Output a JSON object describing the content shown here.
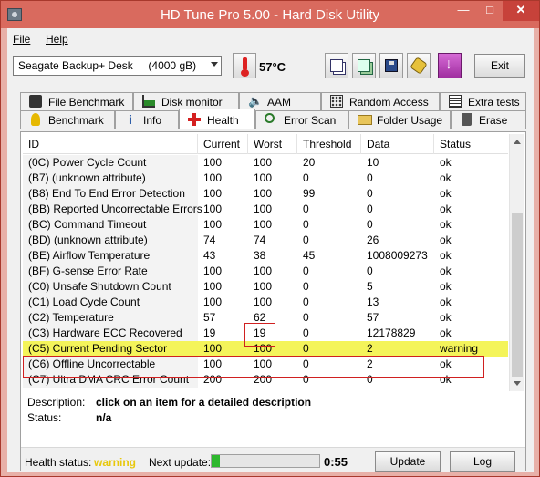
{
  "window": {
    "title": "HD Tune Pro 5.00 - Hard Disk Utility"
  },
  "menu": {
    "file": "File",
    "help": "Help"
  },
  "toolbar": {
    "drive": "Seagate Backup+ Desk     (4000 gB)",
    "temperature": "57°C",
    "exit": "Exit"
  },
  "tabs_top": [
    {
      "label": "File Benchmark",
      "icon": "file-benchmark-icon"
    },
    {
      "label": "Disk monitor",
      "icon": "disk-monitor-icon"
    },
    {
      "label": "AAM",
      "icon": "speaker-icon"
    },
    {
      "label": "Random Access",
      "icon": "random-access-icon"
    },
    {
      "label": "Extra tests",
      "icon": "extra-tests-icon"
    }
  ],
  "tabs_bottom": [
    {
      "label": "Benchmark",
      "icon": "benchmark-icon"
    },
    {
      "label": "Info",
      "icon": "info-icon"
    },
    {
      "label": "Health",
      "icon": "health-cross-icon",
      "active": true
    },
    {
      "label": "Error Scan",
      "icon": "error-scan-icon"
    },
    {
      "label": "Folder Usage",
      "icon": "folder-icon"
    },
    {
      "label": "Erase",
      "icon": "trash-icon"
    }
  ],
  "health_table": {
    "columns": [
      "ID",
      "Current",
      "Worst",
      "Threshold",
      "Data",
      "Status"
    ],
    "rows": [
      {
        "id": "(0C) Power Cycle Count",
        "current": "100",
        "worst": "100",
        "threshold": "20",
        "data": "10",
        "status": "ok"
      },
      {
        "id": "(B7) (unknown attribute)",
        "current": "100",
        "worst": "100",
        "threshold": "0",
        "data": "0",
        "status": "ok"
      },
      {
        "id": "(B8) End To End Error Detection",
        "current": "100",
        "worst": "100",
        "threshold": "99",
        "data": "0",
        "status": "ok"
      },
      {
        "id": "(BB) Reported Uncorrectable Errors",
        "current": "100",
        "worst": "100",
        "threshold": "0",
        "data": "0",
        "status": "ok"
      },
      {
        "id": "(BC) Command Timeout",
        "current": "100",
        "worst": "100",
        "threshold": "0",
        "data": "0",
        "status": "ok"
      },
      {
        "id": "(BD) (unknown attribute)",
        "current": "74",
        "worst": "74",
        "threshold": "0",
        "data": "26",
        "status": "ok"
      },
      {
        "id": "(BE) Airflow Temperature",
        "current": "43",
        "worst": "38",
        "threshold": "45",
        "data": "1008009273",
        "status": "ok"
      },
      {
        "id": "(BF) G-sense Error Rate",
        "current": "100",
        "worst": "100",
        "threshold": "0",
        "data": "0",
        "status": "ok"
      },
      {
        "id": "(C0) Unsafe Shutdown Count",
        "current": "100",
        "worst": "100",
        "threshold": "0",
        "data": "5",
        "status": "ok"
      },
      {
        "id": "(C1) Load Cycle Count",
        "current": "100",
        "worst": "100",
        "threshold": "0",
        "data": "13",
        "status": "ok"
      },
      {
        "id": "(C2) Temperature",
        "current": "57",
        "worst": "62",
        "threshold": "0",
        "data": "57",
        "status": "ok"
      },
      {
        "id": "(C3) Hardware ECC Recovered",
        "current": "19",
        "worst": "19",
        "threshold": "0",
        "data": "12178829",
        "status": "ok"
      },
      {
        "id": "(C5) Current Pending Sector",
        "current": "100",
        "worst": "100",
        "threshold": "0",
        "data": "2",
        "status": "warning",
        "highlight": true
      },
      {
        "id": "(C6) Offline Uncorrectable",
        "current": "100",
        "worst": "100",
        "threshold": "0",
        "data": "2",
        "status": "ok"
      },
      {
        "id": "(C7) Ultra DMA CRC Error Count",
        "current": "200",
        "worst": "200",
        "threshold": "0",
        "data": "0",
        "status": "ok"
      }
    ]
  },
  "description": {
    "desc_label": "Description:",
    "desc_value": "click on an item for a detailed description",
    "status_label": "Status:",
    "status_value": "n/a"
  },
  "footer": {
    "health_label": "Health status:",
    "health_value": "warning",
    "next_label": "Next update:",
    "progress": 0.08,
    "countdown": "0:55",
    "update_btn": "Update",
    "log_btn": "Log"
  },
  "colors": {
    "highlight": "#f4f45a",
    "warning_text": "#e8c80c",
    "annotation": "#d02020",
    "titlebar": "#d96a5e"
  }
}
